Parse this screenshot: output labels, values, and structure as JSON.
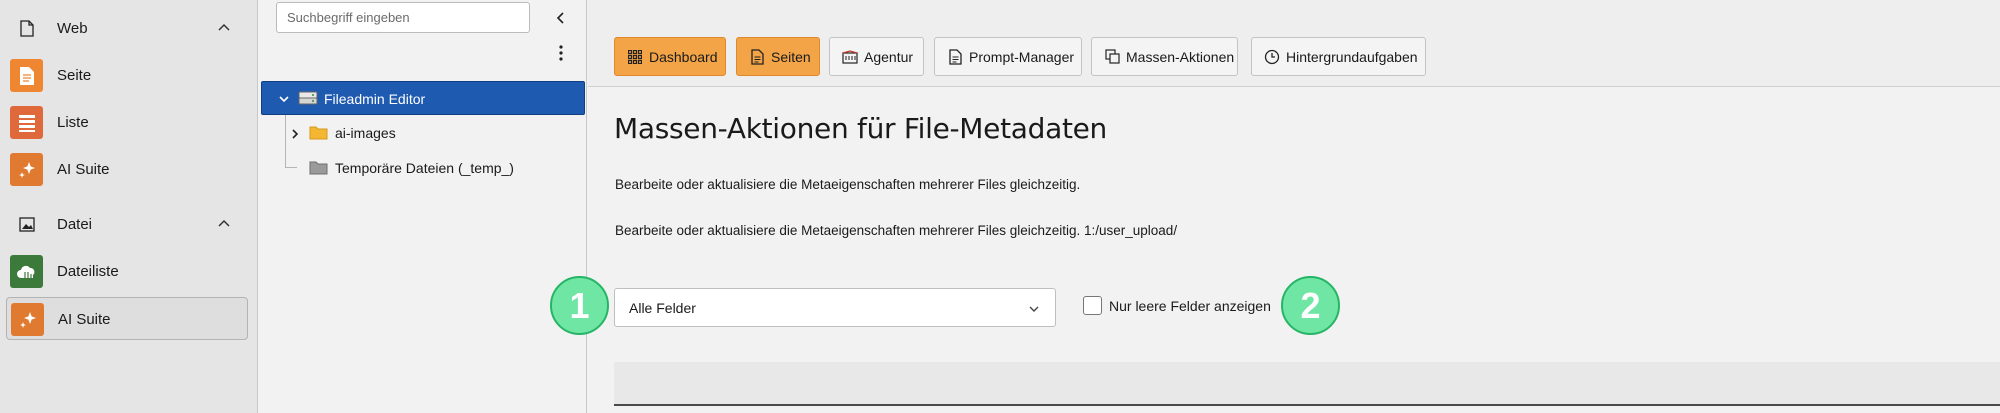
{
  "module_menu": {
    "groups": [
      {
        "label": "Web",
        "icon": "page-icon"
      },
      {
        "label": "Datei",
        "icon": "image-icon"
      }
    ],
    "items": [
      {
        "label": "Seite",
        "icon": "page-module-icon",
        "color": "#ef8632"
      },
      {
        "label": "Liste",
        "icon": "list-module-icon",
        "color": "#e0693b"
      },
      {
        "label": "AI Suite",
        "icon": "ai-sparkle-icon",
        "color": "#e07a30"
      },
      {
        "label": "Dateiliste",
        "icon": "cloud-files-icon",
        "color": "#3c7a3c"
      },
      {
        "label": "AI Suite",
        "icon": "ai-sparkle-icon",
        "color": "#e07a30",
        "active": true
      }
    ]
  },
  "tree": {
    "search_placeholder": "Suchbegriff eingeben",
    "root": {
      "label": "Fileadmin Editor"
    },
    "children": [
      {
        "label": "ai-images"
      },
      {
        "label": "Temporäre Dateien (_temp_)"
      }
    ]
  },
  "toolbar": {
    "buttons": [
      {
        "label": "Dashboard",
        "icon": "grid-icon"
      },
      {
        "label": "Seiten",
        "icon": "document-icon"
      },
      {
        "label": "Agentur",
        "icon": "building-icon"
      },
      {
        "label": "Prompt-Manager",
        "icon": "document-icon"
      },
      {
        "label": "Massen-Aktionen",
        "icon": "copy-icon"
      },
      {
        "label": "Hintergrundaufgaben",
        "icon": "clock-icon"
      }
    ],
    "accent": "#f2a447"
  },
  "content": {
    "title": "Massen-Aktionen für File-Metadaten",
    "description": "Bearbeite oder aktualisiere die Metaeigenschaften mehrerer Files gleichzeitig.",
    "description_path": "Bearbeite oder aktualisiere die Metaeigenschaften mehrerer Files gleichzeitig. 1:/user_upload/",
    "field_select": {
      "value": "Alle Felder"
    },
    "empty_only": {
      "label": "Nur leere Felder anzeigen",
      "checked": false
    },
    "badges": [
      "1",
      "2"
    ]
  }
}
